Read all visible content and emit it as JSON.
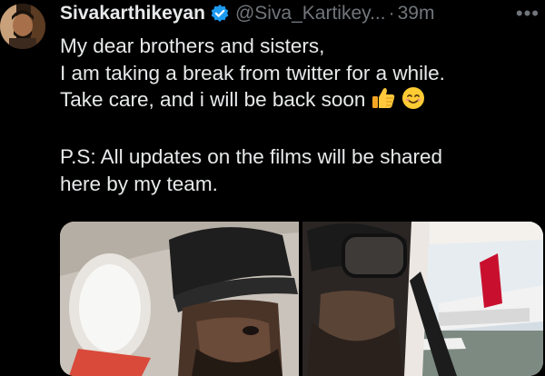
{
  "tweet": {
    "author_name": "Sivakarthikeyan",
    "handle": "@Siva_Kartikey...",
    "separator": "·",
    "time": "39m",
    "more_label": "•••",
    "lines": [
      "My dear brothers and sisters,",
      "I am taking a break from twitter for a while.",
      "Take care, and i will be back soon",
      "",
      "P.S: All updates on the films will be shared",
      "here by my team."
    ],
    "emojis": [
      "thumbs-up",
      "smiling-face"
    ]
  },
  "colors": {
    "background": "#000000",
    "text": "#e7e9ea",
    "secondary_text": "#71767b",
    "verified_badge": "#1d9bf0"
  }
}
